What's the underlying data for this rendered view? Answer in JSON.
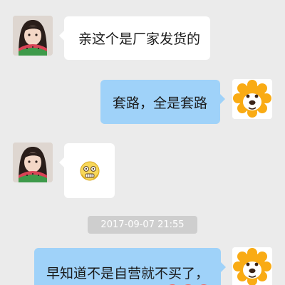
{
  "messages": [
    {
      "side": "left",
      "sender": "girl-avatar",
      "text": "亲这个是厂家发货的"
    },
    {
      "side": "right",
      "sender": "lion-avatar",
      "text": "套路，全是套路"
    },
    {
      "side": "left",
      "sender": "girl-avatar",
      "sticker": "scared-emoji"
    },
    {
      "side": "right",
      "sender": "lion-avatar",
      "text": "早知道不是自营就不买了，"
    }
  ],
  "timestamp": "2017-09-07 21:55",
  "colors": {
    "background": "#ebebeb",
    "incoming_bubble": "#ffffff",
    "outgoing_bubble": "#9fd2f9",
    "timestamp_pill": "#cecece",
    "lion_mane": "#f9ab14",
    "lion_face": "#ffffff",
    "emoji_face": "#f7d75a"
  }
}
